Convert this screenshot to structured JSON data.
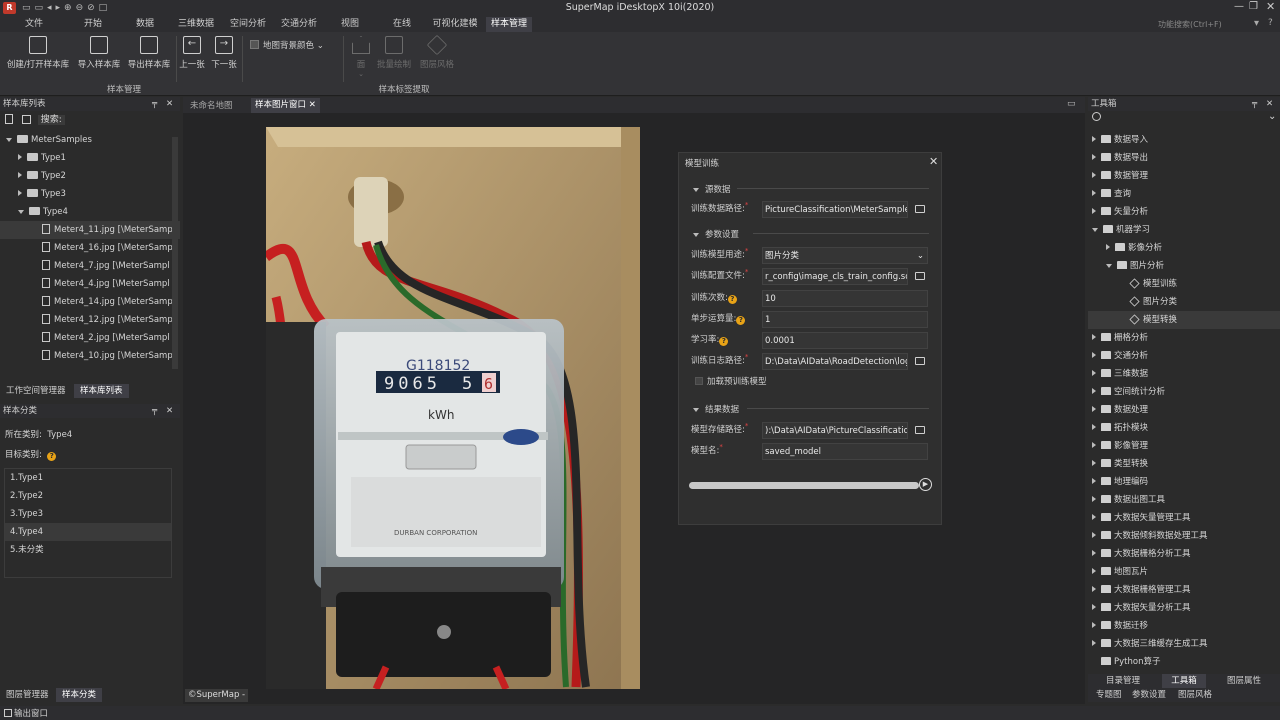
{
  "app": {
    "title": "SuperMap iDesktopX 10i(2020)",
    "search_placeholder": "功能搜索(Ctrl+F)"
  },
  "menu": {
    "file": "文件",
    "tabs": [
      "开始",
      "数据",
      "三维数据",
      "空间分析",
      "交通分析",
      "视图",
      "在线",
      "可视化建模",
      "样本管理"
    ]
  },
  "ribbon": {
    "groups": [
      "样本管理",
      "样本标签提取"
    ],
    "buttons": {
      "create": "创建/打开样本库",
      "import": "导入样本库",
      "export": "导出样本库",
      "prev": "上一张",
      "next": "下一张",
      "map_bg": "地图背景颜色",
      "face": "面",
      "batch": "批量绘制",
      "layer_style": "图层风格"
    }
  },
  "left": {
    "sample_lib_title": "样本库列表",
    "search_label": "搜索:",
    "root": "MeterSamples",
    "folders": [
      "Type1",
      "Type2",
      "Type3",
      "Type4"
    ],
    "files": [
      "Meter4_11.jpg [\\MeterSamp",
      "Meter4_16.jpg [\\MeterSamp",
      "Meter4_7.jpg [\\MeterSampl",
      "Meter4_4.jpg [\\MeterSampl",
      "Meter4_14.jpg [\\MeterSamp",
      "Meter4_12.jpg [\\MeterSamp",
      "Meter4_2.jpg [\\MeterSampl",
      "Meter4_10.jpg [\\MeterSamp"
    ],
    "tabs": [
      "工作空间管理器",
      "样本库列表"
    ],
    "classify_title": "样本分类",
    "current_label": "所在类别:",
    "current_value": "Type4",
    "target_label": "目标类别:",
    "types": [
      "1.Type1",
      "2.Type2",
      "3.Type3",
      "4.Type4",
      "5.未分类"
    ],
    "bottom_tabs": [
      "图层管理器",
      "样本分类"
    ]
  },
  "doc_tabs": [
    "未命名地图",
    "样本图片窗口"
  ],
  "watermark": "©SuperMap -",
  "meter": {
    "reading": "9065",
    "reading_tail": "5",
    "red_digit": "6",
    "unit": "kWh",
    "brand": "DURBAN CORPORATION",
    "handwriting": "G118152"
  },
  "dialog": {
    "title": "模型训练",
    "source_section": "源数据",
    "train_path_label": "训练数据路径:",
    "train_path": "PictureClassification\\MeterSamples",
    "param_section": "参数设置",
    "usage_label": "训练模型用途:",
    "usage": "图片分类",
    "config_label": "训练配置文件:",
    "config": "r_config\\image_cls_train_config.sdt",
    "epochs_label": "训练次数:",
    "epochs": "10",
    "batch_label": "单步运算量:",
    "batch": "1",
    "lr_label": "学习率:",
    "lr": "0.0001",
    "log_label": "训练日志路径:",
    "log": "D:\\Data\\AIData\\RoadDetection\\log",
    "pretrain": "加载预训练模型",
    "result_section": "结果数据",
    "model_path_label": "模型存储路径:",
    "model_path": "):\\Data\\AIData\\PictureClassification",
    "model_name_label": "模型名:",
    "model_name": "saved_model",
    "progress": 0
  },
  "toolbox": {
    "title": "工具箱",
    "items": [
      {
        "label": "数据导入",
        "level": 0,
        "exp": false
      },
      {
        "label": "数据导出",
        "level": 0,
        "exp": false
      },
      {
        "label": "数据管理",
        "level": 0,
        "exp": false
      },
      {
        "label": "查询",
        "level": 0,
        "exp": false
      },
      {
        "label": "矢量分析",
        "level": 0,
        "exp": false
      },
      {
        "label": "机器学习",
        "level": 0,
        "exp": true
      },
      {
        "label": "影像分析",
        "level": 1,
        "exp": false
      },
      {
        "label": "图片分析",
        "level": 1,
        "exp": true
      },
      {
        "label": "模型训练",
        "level": 2,
        "tool": true
      },
      {
        "label": "图片分类",
        "level": 2,
        "tool": true
      },
      {
        "label": "模型转换",
        "level": 2,
        "tool": true,
        "sel": true
      },
      {
        "label": "栅格分析",
        "level": 0,
        "exp": false
      },
      {
        "label": "交通分析",
        "level": 0,
        "exp": false
      },
      {
        "label": "三维数据",
        "level": 0,
        "exp": false
      },
      {
        "label": "空间统计分析",
        "level": 0,
        "exp": false
      },
      {
        "label": "数据处理",
        "level": 0,
        "exp": false
      },
      {
        "label": "拓扑模块",
        "level": 0,
        "exp": false
      },
      {
        "label": "影像管理",
        "level": 0,
        "exp": false
      },
      {
        "label": "类型转换",
        "level": 0,
        "exp": false
      },
      {
        "label": "地理编码",
        "level": 0,
        "exp": false
      },
      {
        "label": "数据出图工具",
        "level": 0,
        "exp": false
      },
      {
        "label": "大数据矢量管理工具",
        "level": 0,
        "exp": false
      },
      {
        "label": "大数据倾斜数据处理工具",
        "level": 0,
        "exp": false
      },
      {
        "label": "大数据栅格分析工具",
        "level": 0,
        "exp": false
      },
      {
        "label": "地图瓦片",
        "level": 0,
        "exp": false
      },
      {
        "label": "大数据栅格管理工具",
        "level": 0,
        "exp": false
      },
      {
        "label": "大数据矢量分析工具",
        "level": 0,
        "exp": false
      },
      {
        "label": "数据迁移",
        "level": 0,
        "exp": false
      },
      {
        "label": "大数据三维缓存生成工具",
        "level": 0,
        "exp": false
      },
      {
        "label": "Python算子",
        "level": 0,
        "exp": null
      }
    ],
    "tabs_row1": [
      "目录管理",
      "工具箱",
      "图层属性"
    ],
    "tabs_row2": [
      "专题图",
      "参数设置",
      "图层风格"
    ]
  },
  "status": {
    "output": "输出窗口"
  }
}
